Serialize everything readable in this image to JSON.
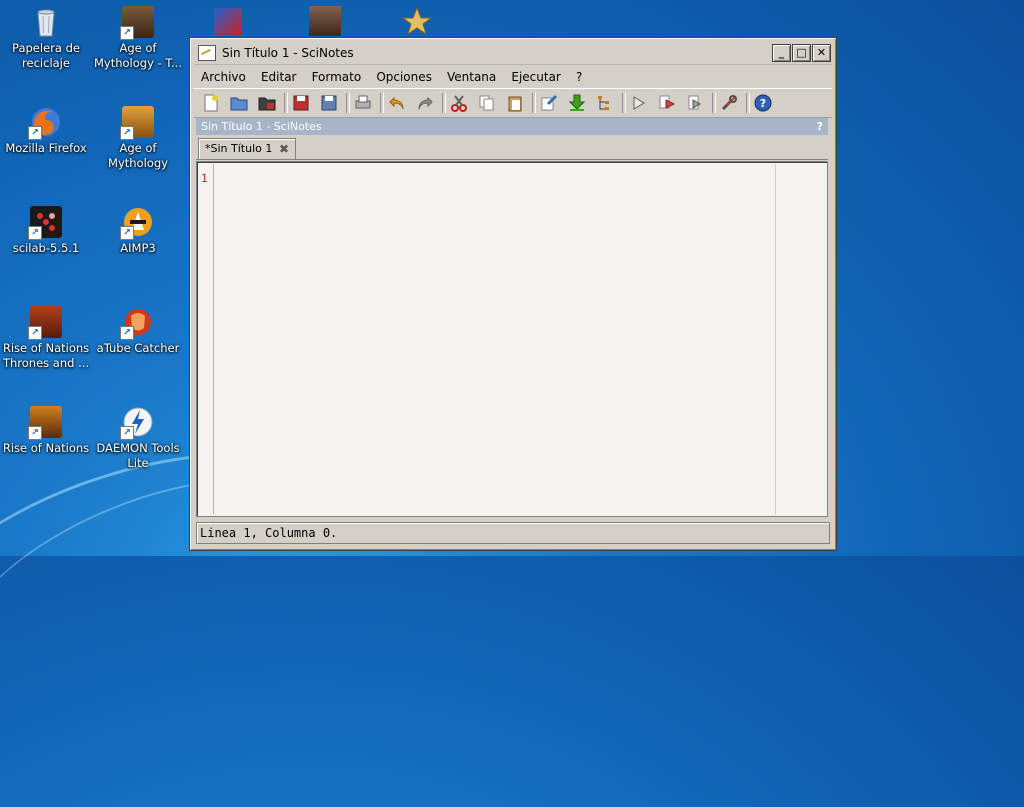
{
  "desktop": {
    "icons": [
      {
        "label": "Papelera de reciclaje",
        "icon": "recycle-bin-icon"
      },
      {
        "label": "Age of Mythology - T...",
        "icon": "age-of-mythology-titans-icon"
      },
      {
        "label": "Mozilla Firefox",
        "icon": "firefox-icon"
      },
      {
        "label": "Age of Mythology",
        "icon": "age-of-mythology-icon"
      },
      {
        "label": "scilab-5.5.1",
        "icon": "scilab-icon"
      },
      {
        "label": "AIMP3",
        "icon": "aimp-icon"
      },
      {
        "label": "Rise of Nations Thrones and ...",
        "icon": "rise-of-nations-thrones-icon"
      },
      {
        "label": "aTube Catcher",
        "icon": "atube-catcher-icon"
      },
      {
        "label": "Rise of Nations",
        "icon": "rise-of-nations-icon"
      },
      {
        "label": "DAEMON Tools Lite",
        "icon": "daemon-tools-icon"
      }
    ],
    "shortcut_arrow": "↗"
  },
  "window": {
    "title": "Sin Título 1 - SciNotes",
    "controls": {
      "minimize": "_",
      "maximize": "□",
      "close": "✕"
    },
    "menu": [
      "Archivo",
      "Editar",
      "Formato",
      "Opciones",
      "Ventana",
      "Ejecutar",
      "?"
    ],
    "doc_header": {
      "title": "Sin Título 1 - SciNotes",
      "help": "?"
    },
    "tab": {
      "label": "*Sin Título 1",
      "close": "✖"
    },
    "editor": {
      "line_number": "1"
    },
    "status": "Linea 1, Columna 0."
  },
  "colors": {
    "accent_header": "#a6b6c8",
    "line_number": "#c02020"
  }
}
